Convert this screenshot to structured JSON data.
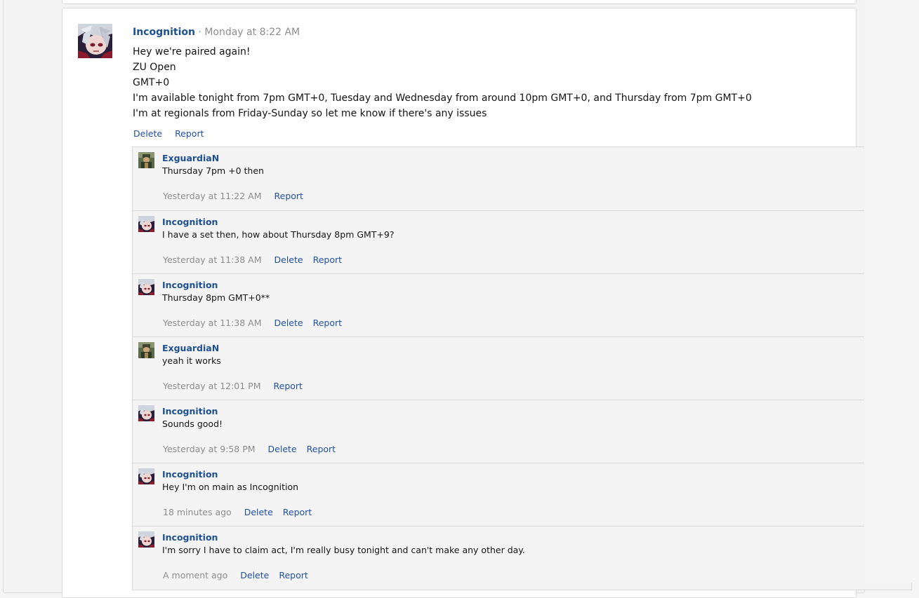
{
  "post": {
    "author": "Incognition",
    "separator": "·",
    "timestamp": "Monday at 8:22 AM",
    "lines": [
      "Hey we're paired again!",
      "ZU Open",
      "GMT+0",
      "I'm available tonight from 7pm GMT+0, Tuesday and Wednesday from around 10pm GMT+0, and Thursday from 7pm GMT+0",
      "I'm at regionals from Friday-Sunday so let me know if there's any issues"
    ],
    "actions": {
      "delete": "Delete",
      "report": "Report"
    },
    "avatar_icon": "anime-avatar-icon"
  },
  "comments": [
    {
      "author": "ExguardiaN",
      "avatar_icon": "soldier-avatar-icon",
      "text": "Thursday 7pm +0 then",
      "timestamp": "Yesterday at 11:22 AM",
      "delete": null,
      "report": "Report"
    },
    {
      "author": "Incognition",
      "avatar_icon": "anime-avatar-icon",
      "text": "I have a set then, how about Thursday 8pm GMT+9?",
      "timestamp": "Yesterday at 11:38 AM",
      "delete": "Delete",
      "report": "Report"
    },
    {
      "author": "Incognition",
      "avatar_icon": "anime-avatar-icon",
      "text": "Thursday 8pm GMT+0**",
      "timestamp": "Yesterday at 11:38 AM",
      "delete": "Delete",
      "report": "Report"
    },
    {
      "author": "ExguardiaN",
      "avatar_icon": "soldier-avatar-icon",
      "text": "yeah it works",
      "timestamp": "Yesterday at 12:01 PM",
      "delete": null,
      "report": "Report"
    },
    {
      "author": "Incognition",
      "avatar_icon": "anime-avatar-icon",
      "text": "Sounds good!",
      "timestamp": "Yesterday at 9:58 PM",
      "delete": "Delete",
      "report": "Report"
    },
    {
      "author": "Incognition",
      "avatar_icon": "anime-avatar-icon",
      "text": "Hey I'm on main as Incognition",
      "timestamp": "18 minutes ago",
      "delete": "Delete",
      "report": "Report"
    },
    {
      "author": "Incognition",
      "avatar_icon": "anime-avatar-icon",
      "text": "I'm sorry I have to claim act, I'm really busy tonight and can't make any other day.",
      "timestamp": "A moment ago",
      "delete": "Delete",
      "report": "Report"
    }
  ],
  "colors": {
    "link": "#2150a0",
    "username": "#1d4f91",
    "muted": "#8c8c8c",
    "comment_bg": "#f4f4f4",
    "card_bg": "#ffffff",
    "border": "#d8d8d8"
  }
}
